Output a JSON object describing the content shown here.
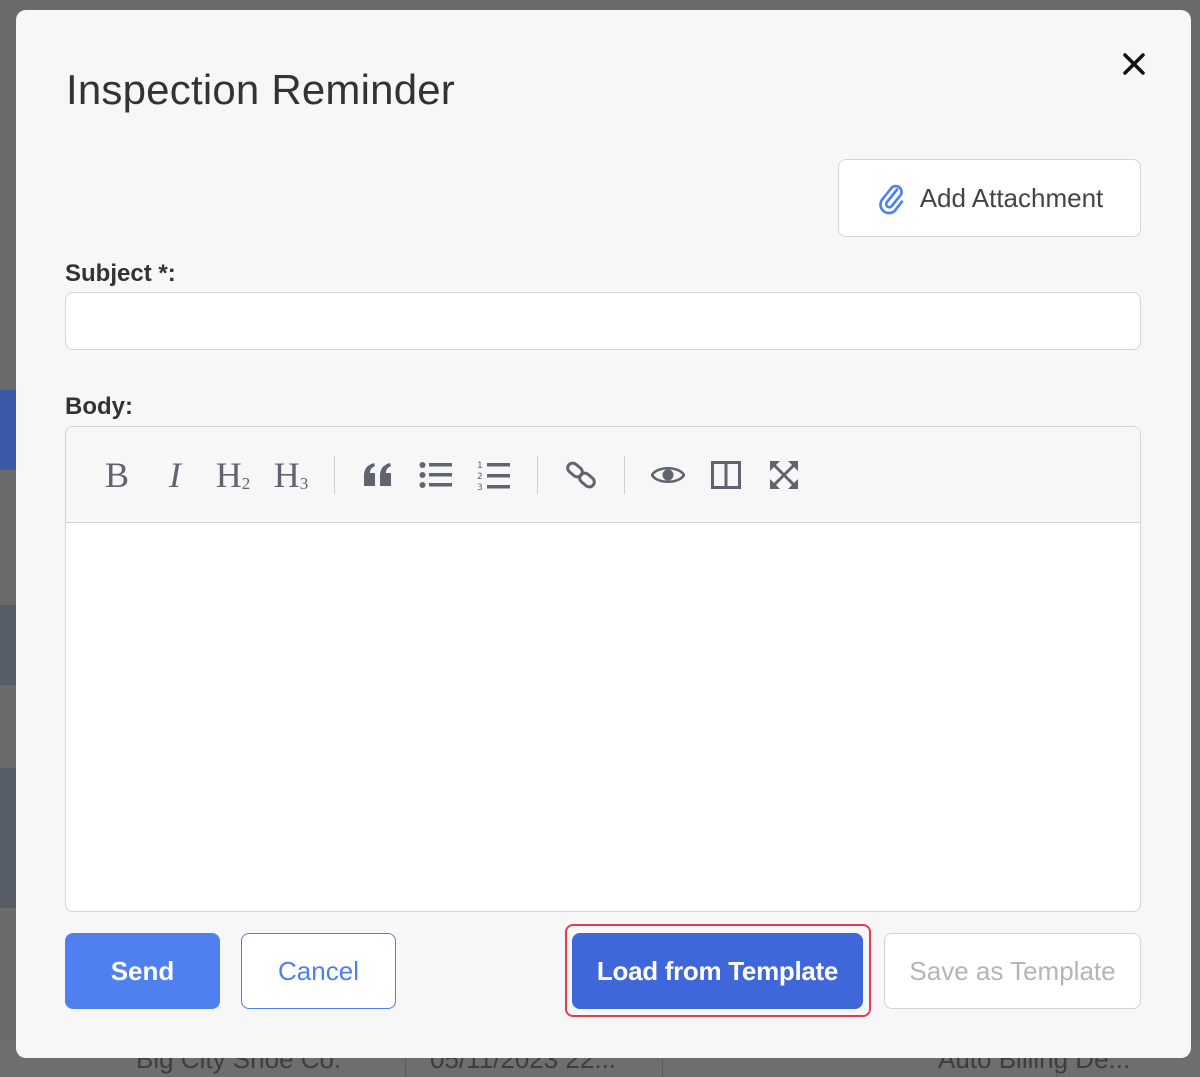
{
  "modal": {
    "title": "Inspection Reminder",
    "close_icon": "close-icon"
  },
  "attachment": {
    "label": "Add Attachment",
    "icon": "paperclip-icon",
    "icon_color": "#4f80f0"
  },
  "form": {
    "subject_label": "Subject *:",
    "subject_value": "",
    "body_label": "Body:"
  },
  "toolbar": {
    "bold": "B",
    "italic": "I",
    "h2": "H",
    "h2_sub": "2",
    "h3": "H",
    "h3_sub": "3"
  },
  "actions": {
    "send": "Send",
    "cancel": "Cancel",
    "load_template": "Load from Template",
    "save_template": "Save as Template"
  },
  "background": {
    "row_cells": [
      "Big City Shoe Co.",
      "05/11/2023 22...",
      "Auto Billing De..."
    ]
  },
  "colors": {
    "primary": "#4f80f0",
    "load_button": "#3f67d9",
    "highlight": "#e23c4e"
  }
}
